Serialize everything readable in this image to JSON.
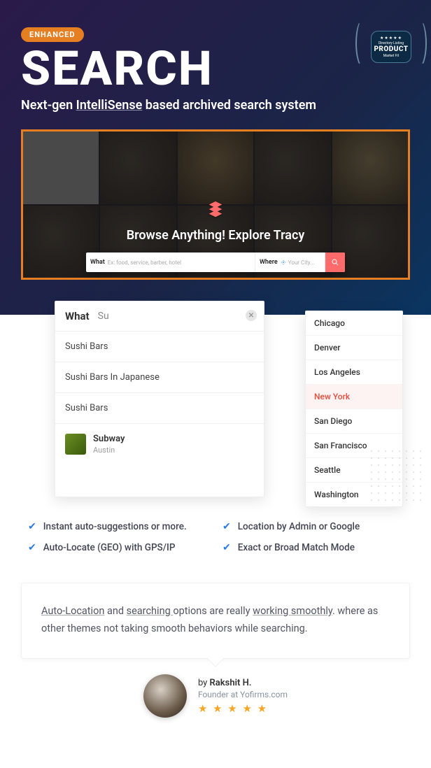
{
  "badge": {
    "label": "ENHANCED"
  },
  "title": "SEARCH",
  "subtitle_pre": "Next-gen ",
  "subtitle_link": "IntelliSense",
  "subtitle_post": " based archived search system",
  "product_badge": {
    "stars": "★★★★★",
    "line1": "Directory Listing",
    "label": "PRODUCT",
    "line2": "Market Fit"
  },
  "preview": {
    "browse_title": "Browse Anything! Explore Tracy",
    "what_label": "What",
    "what_placeholder": "Ex: food, service, barber, hotel",
    "where_label": "Where",
    "where_placeholder": "Your City..."
  },
  "what_dropdown": {
    "header_label": "What",
    "query": "Su",
    "items": [
      {
        "label": "Sushi Bars"
      },
      {
        "label": "Sushi Bars In Japanese"
      },
      {
        "label": "Sushi Bars"
      },
      {
        "title": "Subway",
        "sub": "Austin",
        "thumb": true
      }
    ]
  },
  "where_dropdown": {
    "cities": [
      "Chicago",
      "Denver",
      "Los Angeles",
      "New York",
      "San Diego",
      "San Francisco",
      "Seattle",
      "Washington"
    ],
    "active": "New York"
  },
  "features": [
    "Instant auto-suggestions or more.",
    "Location by Admin or Google",
    "Auto-Locate (GEO) with GPS/IP",
    "Exact or Broad Match Mode"
  ],
  "testimonial": {
    "seg1": "Auto-Location",
    "seg2": " and ",
    "seg3": "searching ",
    "seg4": "options are really ",
    "seg5": "working smoothly",
    "seg6": ". where as other themes not taking smooth behaviors while searching."
  },
  "author": {
    "by": "by ",
    "name": "Rakshit H.",
    "role": "Founder at Yofirms.com",
    "stars": "★ ★ ★ ★ ★"
  }
}
